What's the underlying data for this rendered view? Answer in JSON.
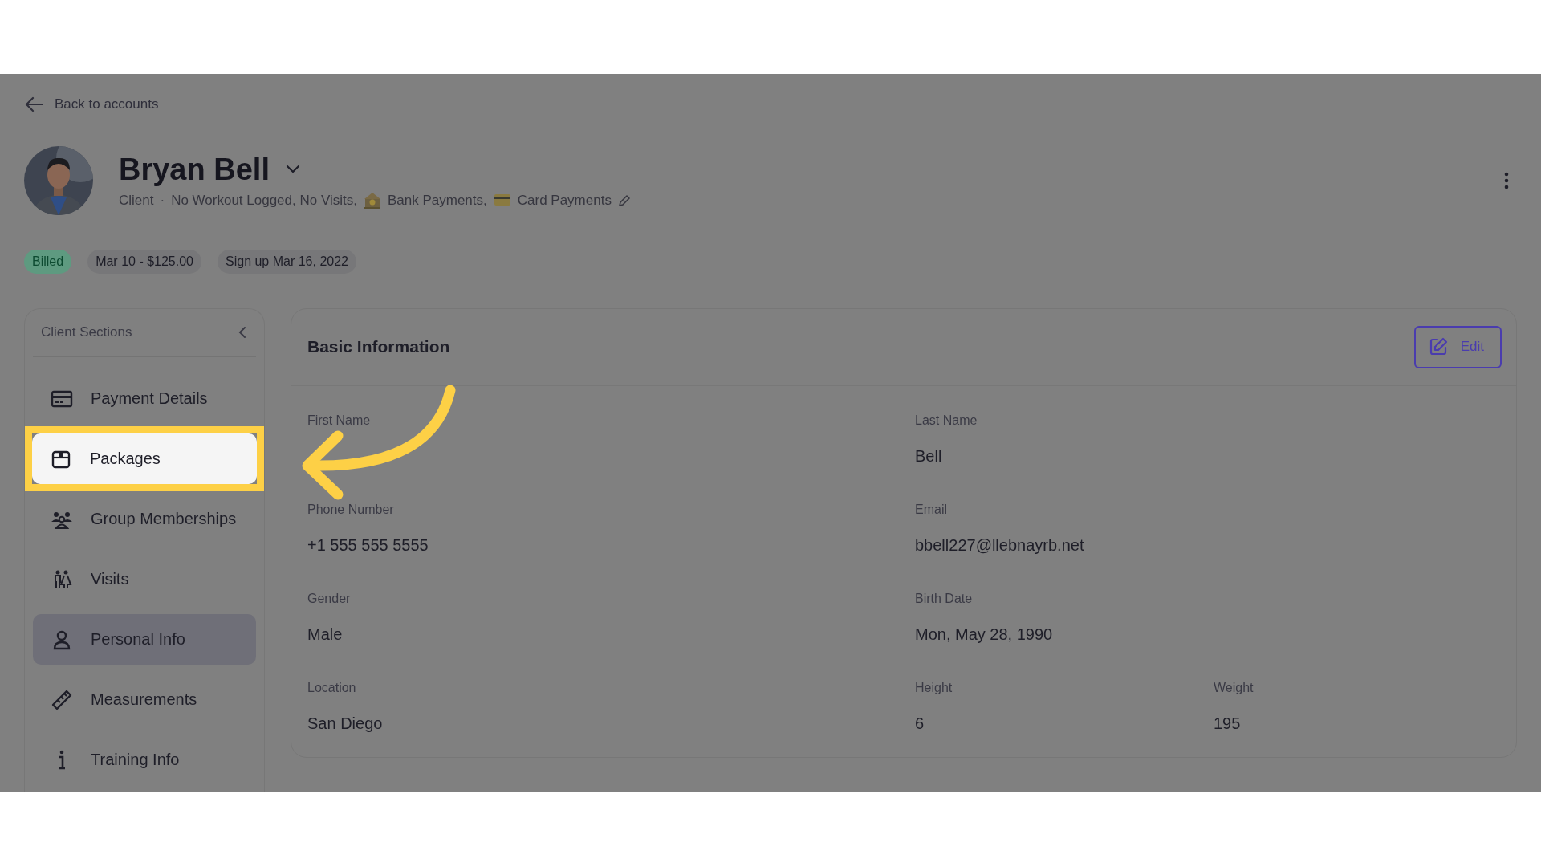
{
  "back_link": "Back to accounts",
  "profile": {
    "name": "Bryan Bell",
    "role": "Client",
    "separator": "·",
    "tags": [
      {
        "kind": "text",
        "text": "No Workout Logged, No Visits,"
      },
      {
        "kind": "bank",
        "text": "Bank Payments,"
      },
      {
        "kind": "card",
        "text": "Card Payments"
      }
    ]
  },
  "pills": [
    {
      "text": "Billed",
      "kind": "status"
    },
    {
      "text": "Mar 10 - $125.00",
      "kind": "plain"
    },
    {
      "text": "Sign up Mar 16, 2022",
      "kind": "plain"
    }
  ],
  "sidebar": {
    "title": "Client Sections",
    "items": [
      {
        "label": "Payment Details",
        "selected": false,
        "highlighted": false
      },
      {
        "label": "Packages",
        "selected": false,
        "highlighted": true
      },
      {
        "label": "Group Memberships",
        "selected": false,
        "highlighted": false
      },
      {
        "label": "Visits",
        "selected": false,
        "highlighted": false
      },
      {
        "label": "Personal Info",
        "selected": true,
        "highlighted": false
      },
      {
        "label": "Measurements",
        "selected": false,
        "highlighted": false
      },
      {
        "label": "Training Info",
        "selected": false,
        "highlighted": false
      }
    ]
  },
  "panel": {
    "title": "Basic Information",
    "edit_button": "Edit",
    "rows": [
      [
        {
          "label": "First Name"
        },
        {
          "label": "Last Name",
          "value": "Bell"
        }
      ],
      [
        {
          "label": "Phone Number",
          "value": "+1 555 555 5555"
        },
        {
          "label": "Email",
          "value": "bbell227@llebnayrb.net"
        }
      ],
      [
        {
          "label": "Gender",
          "value": "Male"
        },
        {
          "label": "Birth Date",
          "value": "Mon, May 28, 1990"
        }
      ],
      [
        {
          "label": "Location",
          "value": "San Diego"
        },
        {
          "label": "Height",
          "value": "6"
        },
        {
          "label": "Weight",
          "value": "195"
        }
      ]
    ]
  }
}
